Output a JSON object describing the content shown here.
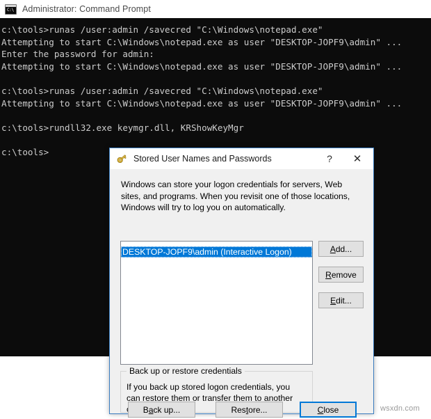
{
  "console": {
    "icon": "command-prompt-icon",
    "icon_glyph": "C:\\",
    "title": "Administrator: Command Prompt",
    "background": "#0c0c0c",
    "foreground": "#cccccc",
    "lines": [
      "c:\\tools>runas /user:admin /savecred \"C:\\Windows\\notepad.exe\"",
      "Attempting to start C:\\Windows\\notepad.exe as user \"DESKTOP-JOPF9\\admin\" ...",
      "Enter the password for admin:",
      "Attempting to start C:\\Windows\\notepad.exe as user \"DESKTOP-JOPF9\\admin\" ...",
      "",
      "c:\\tools>runas /user:admin /savecred \"C:\\Windows\\notepad.exe\"",
      "Attempting to start C:\\Windows\\notepad.exe as user \"DESKTOP-JOPF9\\admin\" ...",
      "",
      "c:\\tools>rundll32.exe keymgr.dll, KRShowKeyMgr",
      "",
      "c:\\tools>"
    ]
  },
  "dialog": {
    "icon": "key-icon",
    "title": "Stored User Names and Passwords",
    "help_label": "?",
    "close_x_label": "✕",
    "intro_text": "Windows can store your logon credentials for servers, Web sites, and programs. When you revisit one of those locations, Windows will try to log you on automatically.",
    "credentials": [
      {
        "label": "",
        "selected": false,
        "clipped": true
      },
      {
        "label": "DESKTOP-JOPF9\\admin (Interactive Logon)",
        "selected": true,
        "clipped": false
      }
    ],
    "side_buttons": [
      {
        "name": "add-button",
        "prefix": "",
        "accel": "A",
        "suffix": "dd..."
      },
      {
        "name": "remove-button",
        "prefix": "",
        "accel": "R",
        "suffix": "emove"
      },
      {
        "name": "edit-button",
        "prefix": "",
        "accel": "E",
        "suffix": "dit..."
      }
    ],
    "backup_group": {
      "legend": "Back up or restore credentials",
      "text": "If you back up stored logon credentials, you can restore them or transfer them to another computer."
    },
    "bottom_buttons": [
      {
        "name": "backup-button",
        "prefix": "B",
        "accel": "a",
        "suffix": "ck up..."
      },
      {
        "name": "restore-button",
        "prefix": "Res",
        "accel": "t",
        "suffix": "ore..."
      },
      {
        "name": "close-button",
        "prefix": "",
        "accel": "C",
        "suffix": "lose",
        "default": true
      }
    ],
    "accent_color": "#0078d7"
  },
  "watermark": {
    "text": "wsxdn.com"
  }
}
